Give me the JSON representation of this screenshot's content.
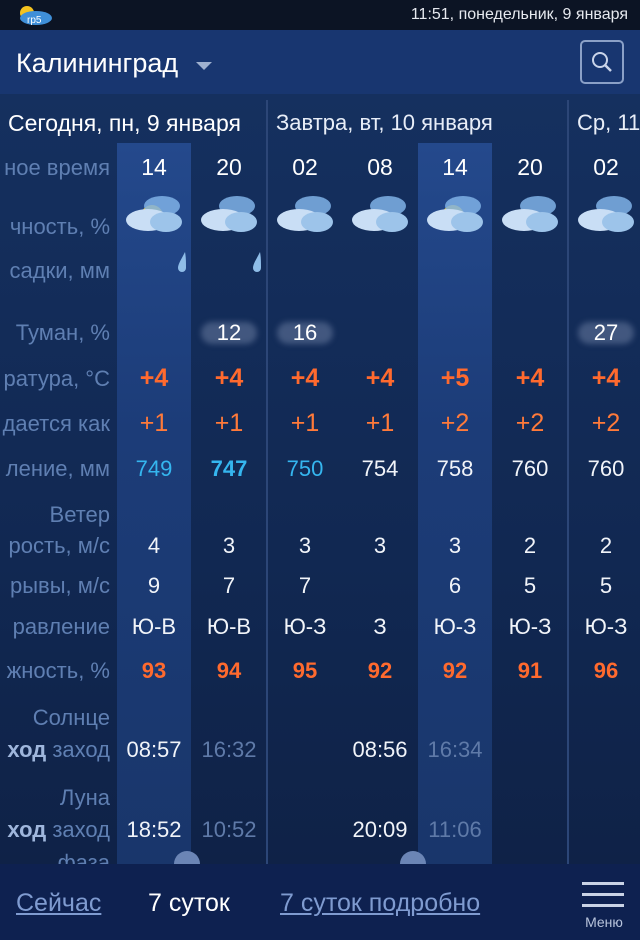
{
  "status_bar": {
    "logo_text": "rp5",
    "time": "11:51, понедельник, 9 января"
  },
  "header": {
    "city": "Калининград"
  },
  "days": [
    {
      "label": "Сегодня, пн, 9 января"
    },
    {
      "label": "Завтра, вт, 10 января"
    },
    {
      "label": "Ср, 11"
    }
  ],
  "row_labels": {
    "local_time": "ное время",
    "cloudiness": "чность, %",
    "precipitation": "садки, мм",
    "fog": "Туман, %",
    "temperature": "ратура, °C",
    "feels_like": "дается как",
    "pressure": "ление, мм",
    "wind": "Ветер",
    "wind_speed": "рость, м/с",
    "gusts": "рывы, м/с",
    "direction": "равление",
    "humidity": "жность, %",
    "sun": "Солнце",
    "sun_row_bold": "ход",
    "sun_row_rest": " заход",
    "moon": "Луна",
    "moon_row_bold": "ход",
    "moon_row_rest": " заход",
    "phase": "фаза"
  },
  "columns": [
    {
      "hour": "14",
      "weather_icon": "cloud-sun-rain-icon",
      "precip_icon": "raindrop-icon",
      "fog": "",
      "temp": "+4",
      "feels": "+1",
      "pressure": "749",
      "wind": "4",
      "gust": "9",
      "dir": "Ю-В",
      "humidity": "93",
      "sun": "08:57",
      "moon": "18:52"
    },
    {
      "hour": "20",
      "weather_icon": "cloud-moon-icon",
      "precip_icon": "raindrop-icon",
      "fog": "12",
      "temp": "+4",
      "feels": "+1",
      "pressure": "747",
      "wind": "3",
      "gust": "7",
      "dir": "Ю-В",
      "humidity": "94",
      "sun": "16:32",
      "moon": "10:52"
    },
    {
      "hour": "02",
      "weather_icon": "cloud-moon-icon",
      "precip_icon": "",
      "fog": "16",
      "temp": "+4",
      "feels": "+1",
      "pressure": "750",
      "wind": "3",
      "gust": "7",
      "dir": "Ю-З",
      "humidity": "95",
      "sun": "",
      "moon": ""
    },
    {
      "hour": "08",
      "weather_icon": "cloud-moon-icon",
      "precip_icon": "",
      "fog": "",
      "temp": "+4",
      "feels": "+1",
      "pressure": "754",
      "wind": "3",
      "gust": "",
      "dir": "З",
      "humidity": "92",
      "sun": "08:56",
      "moon": "20:09"
    },
    {
      "hour": "14",
      "weather_icon": "cloud-sun-icon",
      "precip_icon": "",
      "fog": "",
      "temp": "+5",
      "feels": "+2",
      "pressure": "758",
      "wind": "3",
      "gust": "6",
      "dir": "Ю-З",
      "humidity": "92",
      "sun": "16:34",
      "moon": "11:06"
    },
    {
      "hour": "20",
      "weather_icon": "cloud-moon-icon",
      "precip_icon": "",
      "fog": "",
      "temp": "+4",
      "feels": "+2",
      "pressure": "760",
      "wind": "2",
      "gust": "5",
      "dir": "Ю-З",
      "humidity": "91",
      "sun": "",
      "moon": ""
    },
    {
      "hour": "02",
      "weather_icon": "cloud-moon-icon",
      "precip_icon": "",
      "fog": "27",
      "temp": "+4",
      "feels": "+2",
      "pressure": "760",
      "wind": "2",
      "gust": "5",
      "dir": "Ю-З",
      "humidity": "96",
      "sun": "",
      "moon": ""
    }
  ],
  "colors": {
    "pressure_low": "#35b6ef",
    "pressure_normal": "#f1f4f9",
    "warm": "#ff6a2e",
    "background": "#132a57"
  },
  "bottom_nav": {
    "now": "Сейчас",
    "seven_days": "7 суток",
    "seven_days_detailed": "7 суток подробно",
    "menu": "Меню"
  }
}
